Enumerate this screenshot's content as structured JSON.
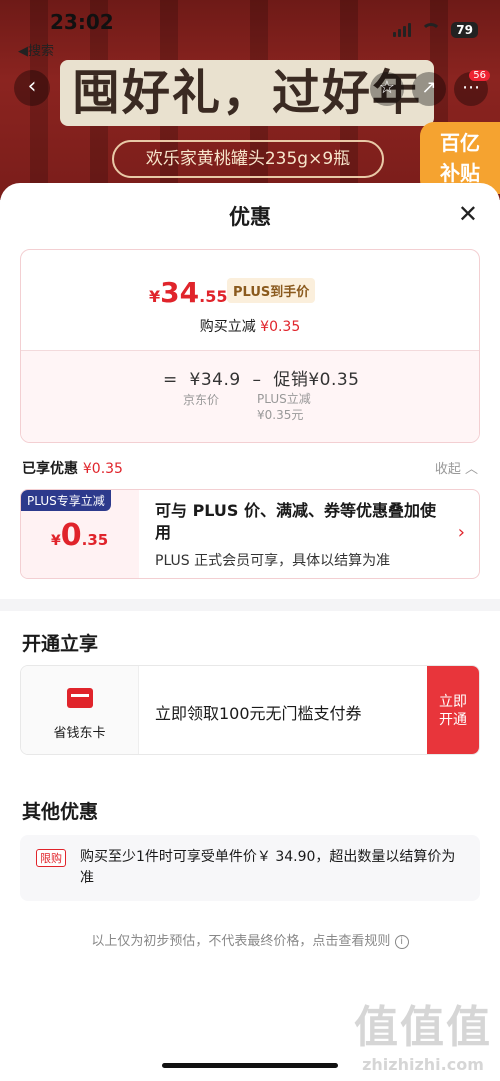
{
  "status_bar": {
    "time": "23:02",
    "back_app": "◀搜索",
    "battery": "79"
  },
  "banner": {
    "headline": "囤好礼，过好年",
    "product": "欢乐家黄桃罐头235g×9瓶",
    "subsidy": "百亿\n补贴",
    "cart_badge": "56"
  },
  "sheet": {
    "title": "优惠",
    "close": "✕",
    "price_card": {
      "symbol": "¥",
      "price_int": "34",
      "price_dec": ".55",
      "plus_tag": "PLUS到手价",
      "buy_reduce_label": "购买立减",
      "buy_reduce_value": "¥0.35",
      "formula": "=  ¥34.9  –  促销¥0.35",
      "jd_price_caption": "京东价",
      "plus_reduce_caption": "PLUS立减",
      "plus_reduce_value": "¥0.35元"
    },
    "enjoyed": {
      "label": "已享优惠",
      "value": "¥0.35",
      "collapse": "收起 ︿"
    },
    "plus_card": {
      "label": "PLUS专享立减",
      "symbol": "¥",
      "amt_int": "0",
      "amt_dec": ".35",
      "desc": "可与 PLUS 价、满减、券等优惠叠加使用",
      "sub": "PLUS 正式会员可享，具体以结算为准",
      "chevron": "›"
    },
    "open_section": {
      "title": "开通立享",
      "card_name": "省钱东卡",
      "desc": "立即领取100元无门槛支付券",
      "button": "立即\n开通"
    },
    "other_section": {
      "title": "其他优惠",
      "tag": "限购",
      "text": "购买至少1件时可享受单件价￥ 34.90，超出数量以结算价为准"
    },
    "footnote": "以上仅为初步预估，不代表最终价格，点击查看规则",
    "info_icon": "i"
  },
  "watermark": {
    "big": "值值值",
    "small": "zhizhizhi.com"
  }
}
